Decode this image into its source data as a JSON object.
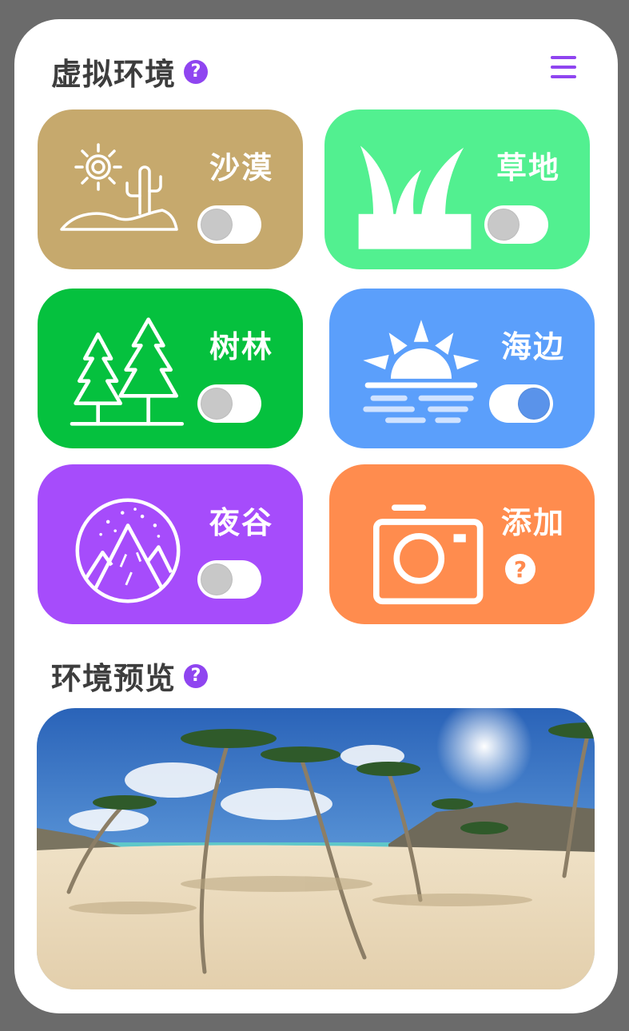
{
  "header": {
    "title": "虚拟环境",
    "help": "?"
  },
  "environments": [
    {
      "label": "沙漠",
      "icon": "desert-cactus-sun-icon",
      "color": "#c6a96d",
      "enabled": false
    },
    {
      "label": "草地",
      "icon": "grass-icon",
      "color": "#52f090",
      "enabled": false
    },
    {
      "label": "树林",
      "icon": "pine-trees-icon",
      "color": "#05c13e",
      "enabled": false
    },
    {
      "label": "海边",
      "icon": "sunset-sea-icon",
      "color": "#5b9ffb",
      "enabled": true
    },
    {
      "label": "夜谷",
      "icon": "night-mountains-icon",
      "color": "#a64cfb",
      "enabled": false
    }
  ],
  "add_card": {
    "label": "添加",
    "icon": "camera-icon",
    "color": "#ff8c4e",
    "help": "?"
  },
  "preview": {
    "title": "环境预览",
    "help": "?",
    "image": "beach-palm-panorama"
  },
  "colors": {
    "accent": "#8f45f0",
    "toggle_on": "#5a93ea",
    "toggle_off": "#c8c8c8"
  }
}
